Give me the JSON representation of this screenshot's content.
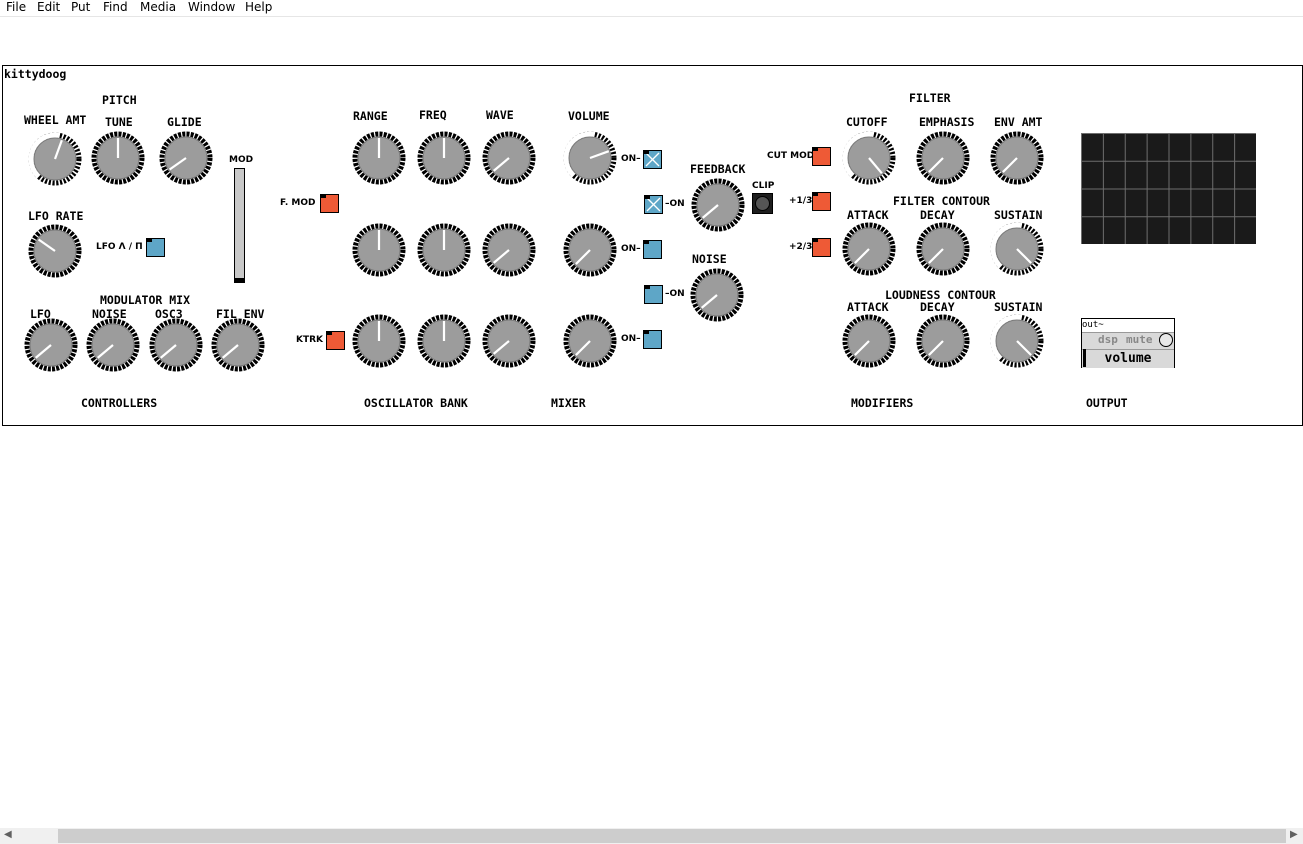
{
  "menu": [
    "File",
    "Edit",
    "Put",
    "Find",
    "Media",
    "Window",
    "Help"
  ],
  "patch_name": "kittydoog",
  "section_labels": {
    "controllers": "CONTROLLERS",
    "oscillator_bank": "OSCILLATOR BANK",
    "mixer": "MIXER",
    "modifiers": "MODIFIERS",
    "output": "OUTPUT"
  },
  "headings": {
    "pitch": "PITCH",
    "modulator_mix": "MODULATOR MIX",
    "filter": "FILTER",
    "filter_contour": "FILTER CONTOUR",
    "loudness_contour": "LOUDNESS CONTOUR"
  },
  "knob_labels": {
    "wheel_amt": "WHEEL AMT",
    "tune": "TUNE",
    "glide": "GLIDE",
    "lfo_rate": "LFO RATE",
    "lfo": "LFO",
    "noise_mod": "NOISE",
    "osc3": "OSC3",
    "fil_env": "FIL ENV",
    "range": "RANGE",
    "freq": "FREQ",
    "wave": "WAVE",
    "volume": "VOLUME",
    "feedback": "FEEDBACK",
    "noise": "NOISE",
    "cutoff": "CUTOFF",
    "emphasis": "EMPHASIS",
    "env_amt": "ENV AMT",
    "f_attack": "ATTACK",
    "f_decay": "DECAY",
    "f_sustain": "SUSTAIN",
    "l_attack": "ATTACK",
    "l_decay": "DECAY",
    "l_sustain": "SUSTAIN"
  },
  "small_labels": {
    "mod": "MOD",
    "lfo_shape": "LFO Λ / Π",
    "f_mod": "F. MOD",
    "ktrk": "KTRK",
    "on1": "ON–",
    "on2": "–ON",
    "on3": "ON–",
    "on4": "–ON",
    "on5": "ON–",
    "clip": "CLIP",
    "cut_mod": "CUT MOD",
    "plus13": "+1/3",
    "plus23": "+2/3"
  },
  "knobs": [
    {
      "id": "wheel_amt",
      "angle": 20,
      "arc": true
    },
    {
      "id": "tune",
      "angle": 0,
      "arc": false
    },
    {
      "id": "glide",
      "angle": -125,
      "arc": false
    },
    {
      "id": "lfo_rate",
      "angle": -55,
      "arc": false
    },
    {
      "id": "lfo",
      "angle": -130,
      "arc": false
    },
    {
      "id": "noise_mod",
      "angle": -130,
      "arc": false
    },
    {
      "id": "osc3",
      "angle": -130,
      "arc": false
    },
    {
      "id": "fil_env",
      "angle": -130,
      "arc": false
    },
    {
      "id": "range1",
      "angle": 0,
      "arc": false
    },
    {
      "id": "freq1",
      "angle": 0,
      "arc": false
    },
    {
      "id": "wave1",
      "angle": -130,
      "arc": false
    },
    {
      "id": "volume1",
      "angle": 70,
      "arc": true
    },
    {
      "id": "range2",
      "angle": 0,
      "arc": false
    },
    {
      "id": "freq2",
      "angle": 0,
      "arc": false
    },
    {
      "id": "wave2",
      "angle": -130,
      "arc": false
    },
    {
      "id": "volume2",
      "angle": -135,
      "arc": false
    },
    {
      "id": "range3",
      "angle": 0,
      "arc": false
    },
    {
      "id": "freq3",
      "angle": 0,
      "arc": false
    },
    {
      "id": "wave3",
      "angle": -130,
      "arc": false
    },
    {
      "id": "volume3",
      "angle": -135,
      "arc": false
    },
    {
      "id": "feedback",
      "angle": -130,
      "arc": false
    },
    {
      "id": "noise",
      "angle": -130,
      "arc": false
    },
    {
      "id": "cutoff",
      "angle": 140,
      "arc": true
    },
    {
      "id": "emphasis",
      "angle": -135,
      "arc": false
    },
    {
      "id": "env_amt",
      "angle": -135,
      "arc": false
    },
    {
      "id": "f_attack",
      "angle": -135,
      "arc": false
    },
    {
      "id": "f_decay",
      "angle": -135,
      "arc": false
    },
    {
      "id": "f_sustain",
      "angle": 135,
      "arc": true
    },
    {
      "id": "l_attack",
      "angle": -135,
      "arc": false
    },
    {
      "id": "l_decay",
      "angle": -135,
      "arc": false
    },
    {
      "id": "l_sustain",
      "angle": 135,
      "arc": true
    }
  ],
  "output": {
    "object": "out~",
    "dsp": "dsp",
    "mute": "mute",
    "volume": "volume"
  },
  "colors": {
    "toggle_orange": "#ee5a36",
    "toggle_blue": "#5ea6c7",
    "knob_body": "#9c9c9c",
    "scope_bg": "#1a1a1a"
  }
}
